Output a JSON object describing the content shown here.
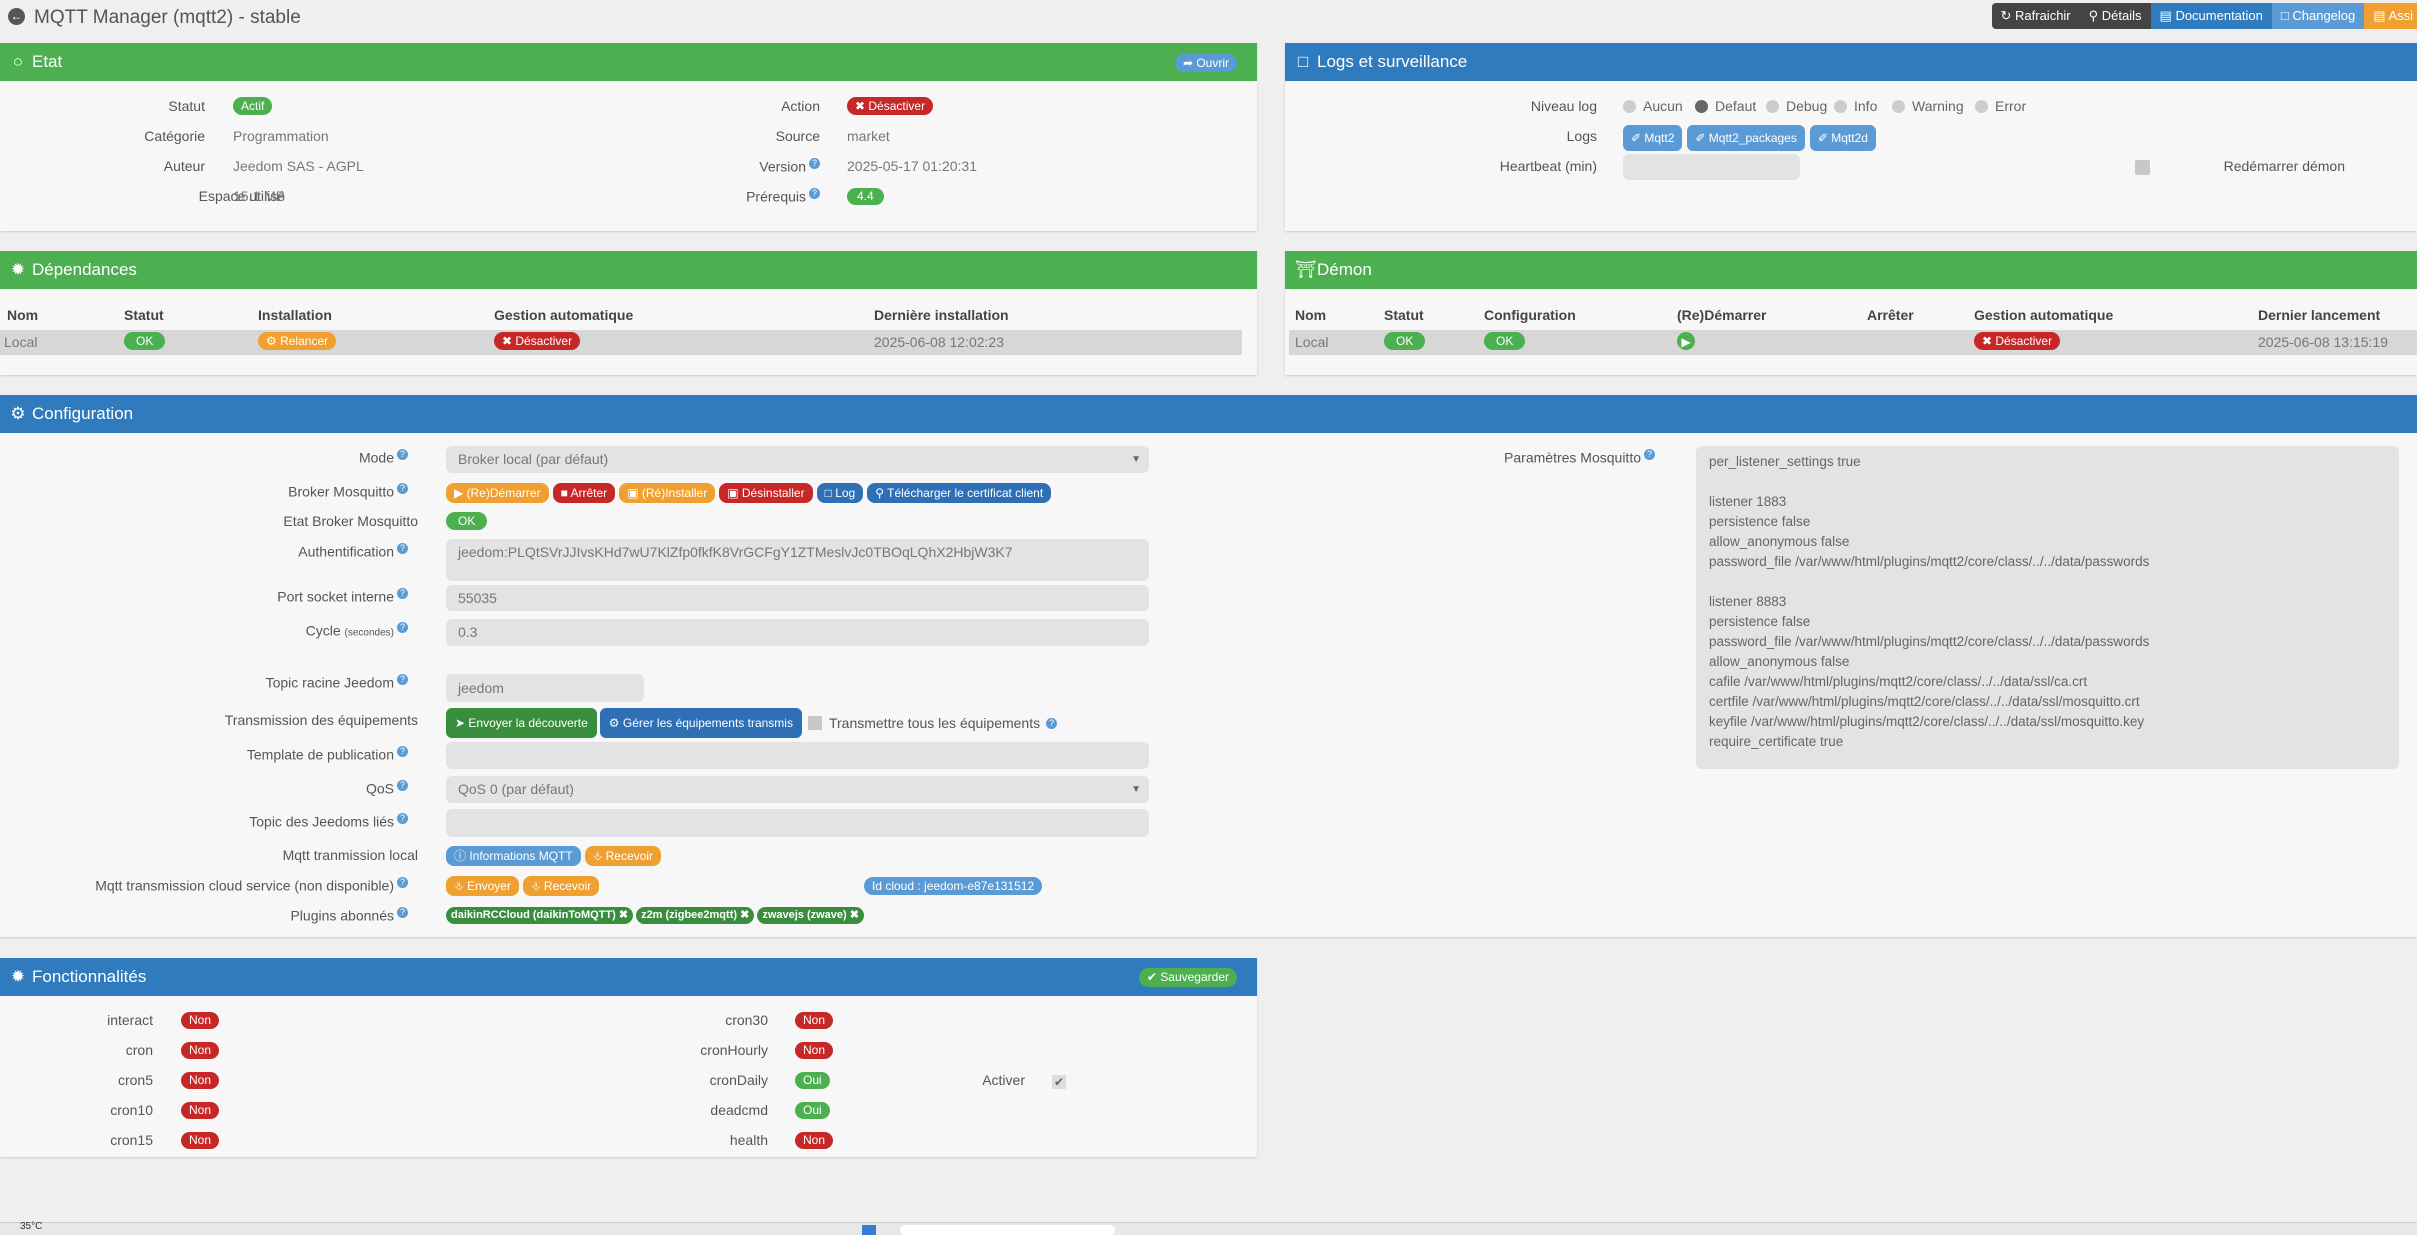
{
  "window": {
    "title": "MQTT Manager (mqtt2) - stable"
  },
  "topbar": {
    "buttons": [
      {
        "label": "Rafraichir",
        "icon": "refresh-icon",
        "color": "#444444"
      },
      {
        "label": "Détails",
        "icon": "search-icon",
        "color": "#444444"
      },
      {
        "label": "Documentation",
        "icon": "book-icon",
        "color": "#2f7bbd"
      },
      {
        "label": "Changelog",
        "icon": "file-icon",
        "color": "#5b9bd5"
      },
      {
        "label": "Assi",
        "icon": "assistant-icon",
        "color": "#f0a030"
      }
    ]
  },
  "etat": {
    "title": "Etat",
    "open_label": "Ouvrir",
    "statut_label": "Statut",
    "statut_value": "Actif",
    "categorie_label": "Catégorie",
    "categorie_value": "Programmation",
    "auteur_label": "Auteur",
    "auteur_value": "Jeedom SAS - AGPL",
    "espace_label": "Espace utilisé",
    "espace_value": "15.1 MB",
    "action_label": "Action",
    "action_value": "Désactiver",
    "source_label": "Source",
    "source_value": "market",
    "version_label": "Version",
    "version_value": "2025-05-17 01:20:31",
    "prerequis_label": "Prérequis",
    "prerequis_value": "4.4"
  },
  "logs": {
    "title": "Logs et surveillance",
    "niveau_label": "Niveau log",
    "levels": [
      "Aucun",
      "Defaut",
      "Debug",
      "Info",
      "Warning",
      "Error"
    ],
    "selected_level": "Defaut",
    "logs_label": "Logs",
    "log_buttons": [
      "Mqtt2",
      "Mqtt2_packages",
      "Mqtt2d"
    ],
    "heartbeat_label": "Heartbeat (min)",
    "heartbeat_value": "",
    "restart_label": "Redémarrer démon"
  },
  "dependances": {
    "title": "Dépendances",
    "headers": [
      "Nom",
      "Statut",
      "Installation",
      "Gestion automatique",
      "Dernière installation"
    ],
    "row": {
      "nom": "Local",
      "statut": "OK",
      "installation": "Relancer",
      "gestion": "Désactiver",
      "derniere": "2025-06-08 12:02:23"
    }
  },
  "demon": {
    "title": "Démon",
    "headers": [
      "Nom",
      "Statut",
      "Configuration",
      "(Re)Démarrer",
      "Arrêter",
      "Gestion automatique",
      "Dernier lancement"
    ],
    "row": {
      "nom": "Local",
      "statut": "OK",
      "configuration": "OK",
      "gestion": "Désactiver",
      "dernier": "2025-06-08 13:15:19"
    }
  },
  "configuration": {
    "title": "Configuration",
    "mode_label": "Mode",
    "mode_value": "Broker local (par défaut)",
    "broker_label": "Broker Mosquitto",
    "broker_buttons": [
      "(Re)Démarrer",
      "Arrêter",
      "(Ré)Installer",
      "Désinstaller",
      "Log",
      "Télécharger le certificat client"
    ],
    "etat_broker_label": "Etat Broker Mosquitto",
    "etat_broker_value": "OK",
    "auth_label": "Authentification",
    "auth_value": "jeedom:PLQtSVrJJIvsKHd7wU7KlZfp0fkfK8VrGCFgY1ZTMeslvJc0TBOqLQhX2HbjW3K7",
    "port_label": "Port socket interne",
    "port_value": "55035",
    "cycle_label": "Cycle",
    "cycle_sub": "(secondes)",
    "cycle_value": "0.3",
    "topic_racine_label": "Topic racine Jeedom",
    "topic_racine_value": "jeedom",
    "transmission_label": "Transmission des équipements",
    "transmission_btn1": "Envoyer la découverte",
    "transmission_btn2": "Gérer les équipements transmis",
    "transmission_chk": "Transmettre tous les équipements",
    "template_label": "Template de publication",
    "template_value": "",
    "qos_label": "QoS",
    "qos_value": "QoS 0 (par défaut)",
    "topic_jeedoms_label": "Topic des Jeedoms liés",
    "topic_jeedoms_value": "",
    "local_label": "Mqtt tranmission local",
    "local_btn1": "Informations MQTT",
    "local_btn2": "Recevoir",
    "cloud_label": "Mqtt transmission cloud service (non disponible)",
    "cloud_btn1": "Envoyer",
    "cloud_btn2": "Recevoir",
    "cloud_id": "Id cloud : jeedom-e87e131512",
    "plugins_label": "Plugins abonnés",
    "plugins": [
      "daikinRCCloud (daikinToMQTT)",
      "z2m (zigbee2mqtt)",
      "zwavejs (zwave)"
    ],
    "mosquitto_label": "Paramètres Mosquitto",
    "mosquitto_value": "per_listener_settings true\n\nlistener 1883\npersistence false\nallow_anonymous false\npassword_file /var/www/html/plugins/mqtt2/core/class/../../data/passwords\n\nlistener 8883\npersistence false\npassword_file /var/www/html/plugins/mqtt2/core/class/../../data/passwords\nallow_anonymous false\ncafile /var/www/html/plugins/mqtt2/core/class/../../data/ssl/ca.crt\ncertfile /var/www/html/plugins/mqtt2/core/class/../../data/ssl/mosquitto.crt\nkeyfile /var/www/html/plugins/mqtt2/core/class/../../data/ssl/mosquitto.key\nrequire_certificate true"
  },
  "fonctionnalites": {
    "title": "Fonctionnalités",
    "save_label": "Sauvegarder",
    "left": [
      {
        "name": "interact",
        "value": "Non"
      },
      {
        "name": "cron",
        "value": "Non"
      },
      {
        "name": "cron5",
        "value": "Non"
      },
      {
        "name": "cron10",
        "value": "Non"
      },
      {
        "name": "cron15",
        "value": "Non"
      }
    ],
    "mid": [
      {
        "name": "cron30",
        "value": "Non"
      },
      {
        "name": "cronHourly",
        "value": "Non"
      },
      {
        "name": "cronDaily",
        "value": "Oui"
      },
      {
        "name": "deadcmd",
        "value": "Oui"
      },
      {
        "name": "health",
        "value": "Non"
      }
    ],
    "activer_label": "Activer"
  },
  "taskbar": {
    "weather": "35°C"
  }
}
